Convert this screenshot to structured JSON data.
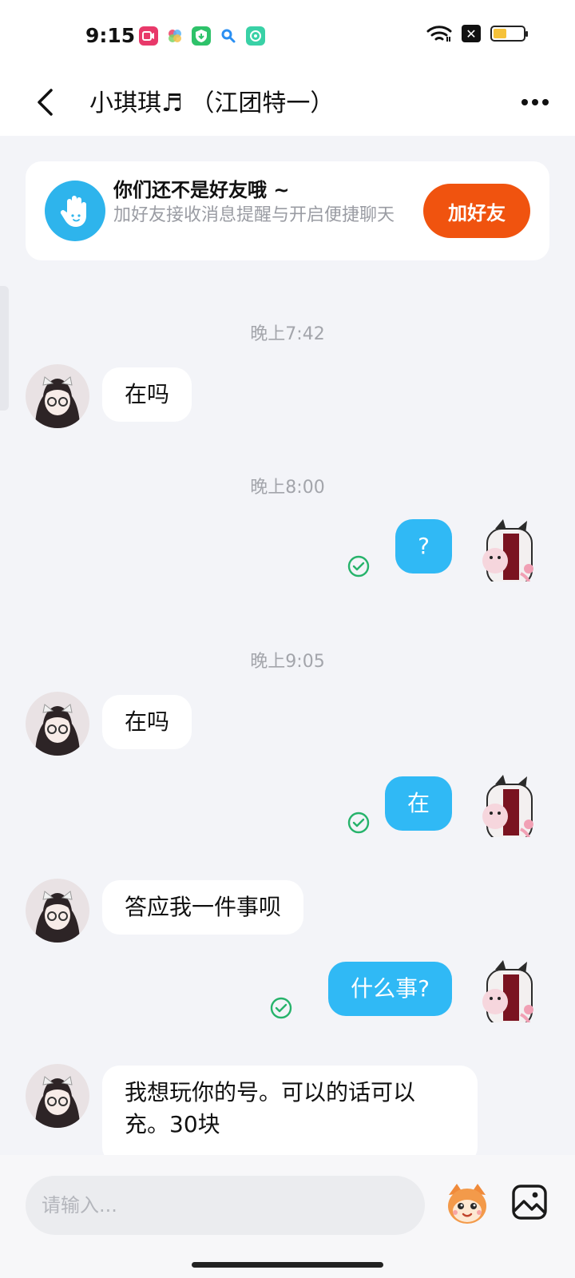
{
  "status_bar": {
    "time": "9:15",
    "app_icons": [
      {
        "name": "video-app-icon",
        "color": "#e8396a"
      },
      {
        "name": "gallery-app-icon",
        "color": "#8f7bef"
      },
      {
        "name": "shield-app-icon",
        "color": "#2ec26a"
      },
      {
        "name": "search-app-icon",
        "color": "#2a8ff2"
      },
      {
        "name": "qq-app-icon",
        "color": "#39d1a6"
      }
    ],
    "battery_level": 0.45
  },
  "header": {
    "title": "小琪琪♬ （江团特一）"
  },
  "friend_banner": {
    "title": "你们还不是好友哦 ~",
    "subtitle": "加好友接收消息提醒与开启便捷聊天",
    "button_label": "加好友"
  },
  "messages": [
    {
      "kind": "time",
      "text": "晚上7:42"
    },
    {
      "kind": "incoming",
      "text": "在吗"
    },
    {
      "kind": "time",
      "text": "晚上8:00"
    },
    {
      "kind": "outgoing",
      "text": "?",
      "read": true
    },
    {
      "kind": "time",
      "text": "晚上9:05"
    },
    {
      "kind": "incoming",
      "text": "在吗"
    },
    {
      "kind": "outgoing",
      "text": "在",
      "read": true
    },
    {
      "kind": "incoming",
      "text": "答应我一件事呗"
    },
    {
      "kind": "outgoing",
      "text": "什么事?",
      "read": true
    },
    {
      "kind": "incoming",
      "text": "我想玩你的号。可以的话可以充。30块"
    }
  ],
  "input": {
    "placeholder": "请输入..."
  },
  "colors": {
    "accent_orange": "#f0530f",
    "outgoing_bubble": "#30b9f5",
    "read_check": "#26b36b"
  }
}
